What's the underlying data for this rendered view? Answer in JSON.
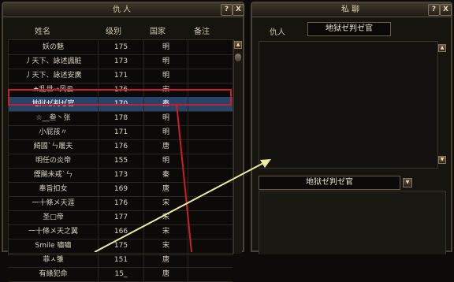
{
  "enemy_panel": {
    "title": "仇人",
    "help_button": "?",
    "close_button": "X",
    "columns": [
      "姓名",
      "级别",
      "国家",
      "备注"
    ],
    "rows": [
      {
        "name": "妖の魅",
        "level": "175",
        "country": "明",
        "note": ""
      },
      {
        "name": "丿天下、詠述諷脏",
        "level": "173",
        "country": "明",
        "note": ""
      },
      {
        "name": "丿天下、詠述安廣",
        "level": "171",
        "country": "明",
        "note": ""
      },
      {
        "name": "★乱世→风云",
        "level": "176",
        "country": "宋",
        "note": ""
      },
      {
        "name": "地狱ゼ判ゼ官",
        "level": "170",
        "country": "秦",
        "note": "",
        "selected": true
      },
      {
        "name": "☆__叁丶张",
        "level": "178",
        "country": "明",
        "note": ""
      },
      {
        "name": "小屁孩〃",
        "level": "171",
        "country": "明",
        "note": ""
      },
      {
        "name": "綺國`ㄣ屠夫",
        "level": "176",
        "country": "唐",
        "note": ""
      },
      {
        "name": "明任の炎帝",
        "level": "155",
        "country": "明",
        "note": ""
      },
      {
        "name": "煙飈未戒`ㄣ",
        "level": "173",
        "country": "秦",
        "note": ""
      },
      {
        "name": "奉旨扣女",
        "level": "169",
        "country": "唐",
        "note": ""
      },
      {
        "name": "一十條メ天涯",
        "level": "176",
        "country": "宋",
        "note": ""
      },
      {
        "name": "圣□帝",
        "level": "177",
        "country": "宋",
        "note": ""
      },
      {
        "name": "一十條メ天之翼",
        "level": "166",
        "country": "宋",
        "note": ""
      },
      {
        "name": "Smile 嘯嘯",
        "level": "175",
        "country": "宋",
        "note": ""
      },
      {
        "name": "菲ㅅ雏",
        "level": "151",
        "country": "唐",
        "note": ""
      },
      {
        "name": "有緣犯命",
        "level": "15_",
        "country": "唐",
        "note": ""
      }
    ]
  },
  "private_chat_panel": {
    "title": "私聊",
    "help_button": "?",
    "close_button": "X",
    "target_label": "仇人",
    "target_name": "地狱ゼ判ゼ官",
    "input_target_name": "地狱ゼ判ゼ官"
  },
  "colors": {
    "selection_outline": "#c8202a",
    "annotation_arrow": "#ecec9a",
    "annotation_line": "#cc2020"
  }
}
